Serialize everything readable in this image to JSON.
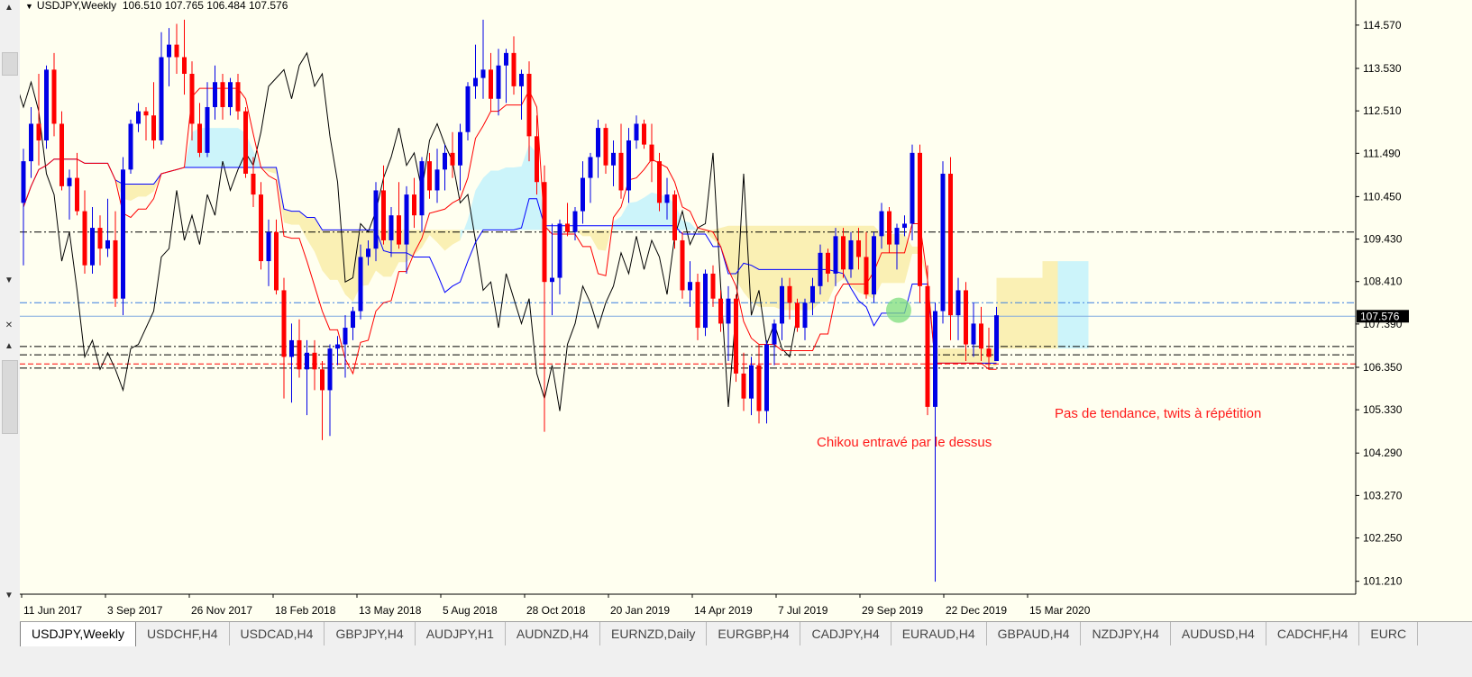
{
  "header": {
    "symbol": "USDJPY,Weekly",
    "ohlc": "106.510 107.765 106.484 107.576"
  },
  "price_axis": {
    "labels": [
      "114.570",
      "113.530",
      "112.510",
      "111.490",
      "110.450",
      "109.430",
      "108.410",
      "107.390",
      "106.350",
      "105.330",
      "104.290",
      "103.270",
      "102.250",
      "101.210"
    ],
    "current_price": "107.576"
  },
  "time_axis": {
    "labels": [
      "11 Jun 2017",
      "3 Sep 2017",
      "26 Nov 2017",
      "18 Feb 2018",
      "13 May 2018",
      "5 Aug 2018",
      "28 Oct 2018",
      "20 Jan 2019",
      "14 Apr 2019",
      "7 Jul 2019",
      "29 Sep 2019",
      "22 Dec 2019",
      "15 Mar 2020"
    ]
  },
  "annotations": {
    "chikou": "Chikou entravé par le dessus",
    "no_trend": "Pas de tendance, twits à répétition"
  },
  "tabs": [
    "USDJPY,Weekly",
    "USDCHF,H4",
    "USDCAD,H4",
    "GBPJPY,H4",
    "AUDJPY,H1",
    "AUDNZD,H4",
    "EURNZD,Daily",
    "EURGBP,H4",
    "CADJPY,H4",
    "EURAUD,H4",
    "GBPAUD,H4",
    "NZDJPY,H4",
    "AUDUSD,H4",
    "CADCHF,H4",
    "EURC"
  ],
  "colors": {
    "background": "#fffff0",
    "bull": "#0000e6",
    "bear": "#ff0000",
    "tenkan": "#ff0000",
    "kijun": "#0000ff",
    "chikou": "#000000",
    "kumo_bull": "#ccf4fa",
    "kumo_bear": "#faf0b4"
  },
  "chart_data": {
    "type": "candlestick",
    "ylim": [
      100.9,
      115.0
    ],
    "x": [
      "11 Jun 2017",
      "3 Sep 2017",
      "26 Nov 2017",
      "18 Feb 2018",
      "13 May 2018",
      "5 Aug 2018",
      "28 Oct 2018",
      "20 Jan 2019",
      "14 Apr 2019",
      "7 Jul 2019",
      "29 Sep 2019",
      "22 Dec 2019",
      "15 Mar 2020"
    ],
    "horizontal_levels": [
      {
        "value": 109.6,
        "style": "dashdot",
        "color": "#000000"
      },
      {
        "value": 107.9,
        "style": "dashdot",
        "color": "#3a7fe0"
      },
      {
        "value": 107.576,
        "style": "solid",
        "color": "#7fa9e0"
      },
      {
        "value": 106.85,
        "style": "dashdot",
        "color": "#000000"
      },
      {
        "value": 106.65,
        "style": "dashdot",
        "color": "#000000"
      },
      {
        "value": 106.43,
        "style": "dashed",
        "color": "#ff0000"
      },
      {
        "value": 106.33,
        "style": "dashdot",
        "color": "#000000"
      }
    ],
    "candles_ohlc": [
      [
        110.3,
        111.6,
        108.8,
        111.3
      ],
      [
        111.3,
        112.6,
        110.9,
        112.2
      ],
      [
        112.2,
        113.4,
        111.2,
        111.8
      ],
      [
        111.8,
        113.6,
        111.6,
        113.5
      ],
      [
        113.5,
        113.9,
        111.9,
        112.2
      ],
      [
        112.2,
        112.5,
        110.6,
        110.7
      ],
      [
        110.7,
        111.1,
        109.9,
        110.9
      ],
      [
        110.9,
        111.5,
        110.0,
        110.1
      ],
      [
        110.1,
        110.6,
        108.6,
        108.8
      ],
      [
        108.8,
        110.2,
        108.6,
        109.7
      ],
      [
        109.7,
        110.0,
        108.8,
        109.2
      ],
      [
        109.2,
        110.4,
        109.0,
        109.4
      ],
      [
        109.4,
        110.1,
        107.8,
        108.0
      ],
      [
        108.0,
        111.4,
        107.6,
        111.1
      ],
      [
        111.1,
        112.3,
        111.0,
        112.2
      ],
      [
        112.2,
        112.7,
        112.0,
        112.5
      ],
      [
        112.5,
        112.6,
        111.8,
        112.4
      ],
      [
        112.4,
        113.2,
        111.6,
        111.8
      ],
      [
        111.8,
        114.4,
        111.7,
        113.8
      ],
      [
        113.8,
        114.5,
        113.1,
        114.1
      ],
      [
        114.1,
        114.6,
        113.4,
        113.8
      ],
      [
        113.8,
        114.7,
        112.9,
        113.4
      ],
      [
        113.4,
        113.7,
        111.8,
        112.2
      ],
      [
        112.2,
        112.7,
        111.4,
        111.5
      ],
      [
        111.5,
        113.2,
        111.4,
        112.6
      ],
      [
        112.6,
        113.6,
        112.3,
        113.2
      ],
      [
        113.2,
        113.4,
        112.3,
        112.6
      ],
      [
        112.6,
        113.3,
        112.4,
        113.2
      ],
      [
        113.2,
        113.4,
        112.3,
        112.5
      ],
      [
        112.5,
        112.6,
        110.9,
        111.0
      ],
      [
        111.0,
        111.4,
        110.2,
        110.5
      ],
      [
        110.5,
        110.8,
        108.7,
        108.9
      ],
      [
        108.9,
        109.9,
        108.3,
        109.6
      ],
      [
        109.6,
        109.9,
        108.1,
        108.2
      ],
      [
        108.2,
        108.5,
        105.6,
        106.6
      ],
      [
        106.6,
        107.4,
        105.5,
        107.0
      ],
      [
        107.0,
        107.5,
        106.1,
        106.3
      ],
      [
        106.3,
        107.0,
        105.2,
        106.7
      ],
      [
        106.7,
        107.0,
        105.8,
        106.3
      ],
      [
        106.3,
        106.5,
        104.6,
        105.8
      ],
      [
        105.8,
        106.9,
        104.7,
        106.8
      ],
      [
        106.8,
        107.1,
        106.4,
        106.9
      ],
      [
        106.9,
        107.6,
        106.1,
        107.3
      ],
      [
        107.3,
        107.8,
        107.0,
        107.7
      ],
      [
        107.7,
        109.3,
        107.5,
        109.0
      ],
      [
        109.0,
        109.4,
        108.8,
        109.2
      ],
      [
        109.2,
        110.8,
        108.9,
        110.6
      ],
      [
        110.6,
        111.2,
        109.3,
        109.4
      ],
      [
        109.4,
        110.2,
        109.0,
        110.0
      ],
      [
        110.0,
        110.8,
        109.2,
        109.3
      ],
      [
        109.3,
        110.7,
        108.6,
        110.5
      ],
      [
        110.5,
        110.9,
        109.7,
        110.0
      ],
      [
        110.0,
        111.4,
        109.6,
        111.3
      ],
      [
        111.3,
        111.5,
        110.4,
        110.6
      ],
      [
        110.6,
        111.6,
        110.3,
        111.1
      ],
      [
        111.1,
        111.7,
        110.6,
        111.5
      ],
      [
        111.5,
        112.0,
        110.9,
        111.2
      ],
      [
        111.2,
        112.2,
        110.6,
        112.0
      ],
      [
        112.0,
        113.2,
        111.8,
        113.1
      ],
      [
        113.1,
        114.1,
        112.8,
        113.3
      ],
      [
        113.3,
        114.7,
        112.8,
        113.5
      ],
      [
        113.5,
        113.9,
        112.5,
        112.8
      ],
      [
        112.8,
        114.0,
        112.4,
        113.6
      ],
      [
        113.6,
        114.0,
        112.7,
        113.9
      ],
      [
        113.9,
        114.3,
        112.9,
        113.1
      ],
      [
        113.1,
        113.5,
        112.3,
        113.4
      ],
      [
        113.4,
        113.7,
        111.3,
        111.9
      ],
      [
        111.9,
        112.4,
        110.5,
        110.8
      ],
      [
        110.8,
        111.2,
        104.8,
        108.4
      ],
      [
        108.4,
        109.8,
        107.6,
        108.5
      ],
      [
        108.5,
        109.9,
        108.1,
        109.8
      ],
      [
        109.8,
        110.3,
        109.5,
        109.6
      ],
      [
        109.6,
        110.2,
        109.4,
        110.1
      ],
      [
        110.1,
        111.3,
        109.8,
        110.9
      ],
      [
        110.9,
        111.5,
        110.3,
        111.4
      ],
      [
        111.4,
        112.3,
        110.9,
        112.1
      ],
      [
        112.1,
        112.2,
        111.0,
        111.2
      ],
      [
        111.2,
        111.8,
        110.7,
        111.5
      ],
      [
        111.5,
        112.2,
        110.4,
        110.6
      ],
      [
        110.6,
        112.1,
        110.3,
        111.8
      ],
      [
        111.8,
        112.4,
        111.6,
        112.2
      ],
      [
        112.2,
        112.3,
        111.6,
        111.7
      ],
      [
        111.7,
        112.2,
        110.8,
        111.3
      ],
      [
        111.3,
        111.5,
        110.1,
        110.3
      ],
      [
        110.3,
        110.9,
        109.9,
        110.5
      ],
      [
        110.5,
        110.6,
        109.2,
        109.4
      ],
      [
        109.4,
        109.6,
        108.0,
        108.2
      ],
      [
        108.2,
        108.9,
        107.8,
        108.4
      ],
      [
        108.4,
        108.6,
        107.0,
        107.3
      ],
      [
        107.3,
        108.7,
        107.1,
        108.6
      ],
      [
        108.6,
        108.8,
        107.8,
        108.0
      ],
      [
        108.0,
        108.2,
        107.2,
        107.4
      ],
      [
        107.4,
        108.3,
        106.5,
        108.0
      ],
      [
        108.0,
        108.1,
        106.0,
        106.2
      ],
      [
        106.2,
        106.7,
        105.3,
        105.6
      ],
      [
        105.6,
        106.6,
        105.2,
        106.4
      ],
      [
        106.4,
        106.9,
        105.0,
        105.3
      ],
      [
        105.3,
        107.0,
        105.0,
        106.9
      ],
      [
        106.9,
        107.5,
        106.4,
        107.4
      ],
      [
        107.4,
        108.5,
        107.0,
        108.3
      ],
      [
        108.3,
        108.5,
        107.5,
        107.9
      ],
      [
        107.9,
        108.0,
        107.2,
        107.3
      ],
      [
        107.3,
        108.0,
        107.0,
        107.9
      ],
      [
        107.9,
        108.5,
        107.6,
        108.3
      ],
      [
        108.3,
        109.3,
        108.1,
        109.1
      ],
      [
        109.1,
        109.2,
        108.4,
        108.6
      ],
      [
        108.6,
        109.7,
        108.3,
        109.5
      ],
      [
        109.5,
        109.7,
        108.5,
        108.7
      ],
      [
        108.7,
        109.6,
        108.5,
        109.4
      ],
      [
        109.4,
        109.7,
        108.7,
        109.0
      ],
      [
        109.0,
        109.6,
        108.0,
        108.1
      ],
      [
        108.1,
        109.6,
        107.9,
        109.5
      ],
      [
        109.5,
        110.3,
        109.2,
        110.1
      ],
      [
        110.1,
        110.2,
        109.1,
        109.3
      ],
      [
        109.3,
        109.8,
        108.7,
        109.7
      ],
      [
        109.7,
        110.0,
        109.5,
        109.8
      ],
      [
        109.8,
        111.7,
        109.4,
        111.5
      ],
      [
        111.5,
        111.7,
        107.9,
        108.3
      ],
      [
        108.3,
        108.8,
        105.2,
        105.4
      ],
      [
        105.4,
        107.9,
        101.2,
        107.7
      ],
      [
        107.7,
        111.3,
        107.4,
        111.0
      ],
      [
        111.0,
        111.4,
        107.0,
        107.6
      ],
      [
        107.6,
        108.5,
        107.0,
        108.2
      ],
      [
        108.2,
        108.4,
        106.5,
        106.9
      ],
      [
        106.9,
        107.9,
        106.6,
        107.4
      ],
      [
        107.4,
        107.8,
        106.5,
        106.8
      ],
      [
        106.8,
        107.3,
        106.3,
        106.6
      ],
      [
        106.5,
        107.8,
        106.5,
        107.6
      ]
    ]
  }
}
